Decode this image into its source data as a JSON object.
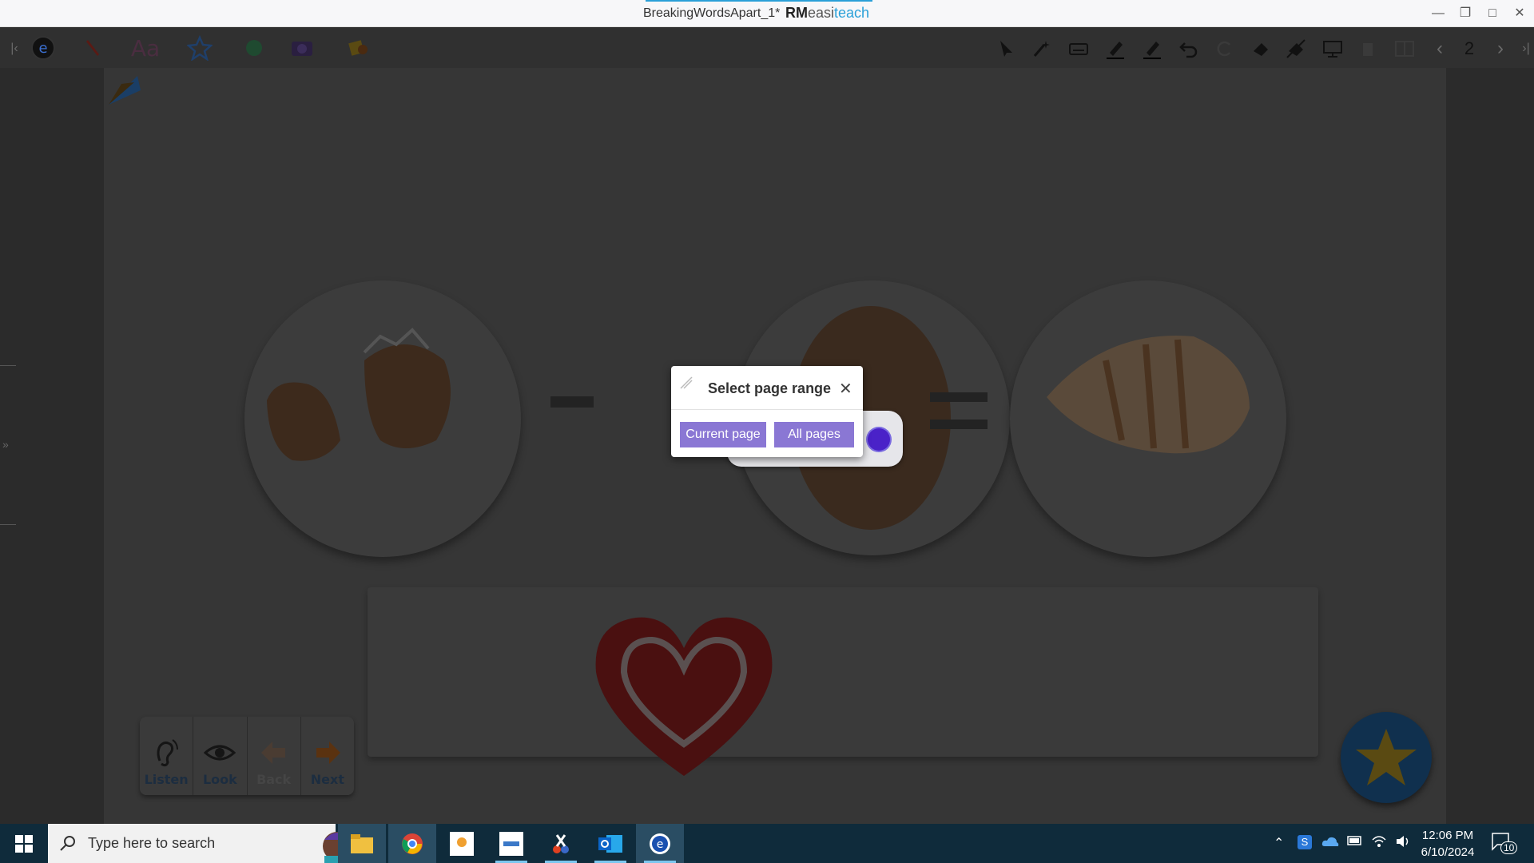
{
  "window": {
    "title": "BreakingWordsApart_1*",
    "brand_rm": "RM",
    "brand_easi": "easi",
    "brand_teach": "teach",
    "controls": [
      "minimize",
      "restore",
      "maximize",
      "close"
    ]
  },
  "toolbar": {
    "left_tools": [
      "easiteach-logo-icon",
      "pen-icon",
      "text-icon",
      "star-icon",
      "hand-icon",
      "camera-icon",
      "shapes-icon"
    ],
    "text_tool_label": "Aa",
    "right_tools": [
      "select-icon",
      "magic-wand-icon",
      "keyboard-icon",
      "highlighter-icon",
      "marker-icon",
      "undo-icon",
      "redo-icon",
      "eraser-icon",
      "clear-icon",
      "screen-icon",
      "delete-icon",
      "page-icon",
      "prev-page-icon",
      "next-page-icon"
    ],
    "page_number": "2"
  },
  "canvas": {
    "operator_minus": "minus",
    "operator_equals": "equals",
    "images": [
      "cracked-egg-shell",
      "egg",
      "sea-shell",
      "heart"
    ]
  },
  "nav_buttons": [
    {
      "label": "Listen",
      "icon": "ear-icon"
    },
    {
      "label": "Look",
      "icon": "eye-icon"
    },
    {
      "label": "Back",
      "icon": "back-arrow-icon"
    },
    {
      "label": "Next",
      "icon": "next-arrow-icon"
    }
  ],
  "dialog": {
    "title": "Select page range",
    "current_page_label": "Current page",
    "all_pages_label": "All pages",
    "close_symbol": "✕"
  },
  "taskbar": {
    "search_placeholder": "Type here to search",
    "apps": [
      "file-explorer",
      "chrome",
      "ignite",
      "learning-panel",
      "snipping-tool",
      "outlook",
      "easiteach"
    ],
    "time": "12:06 PM",
    "date": "6/10/2024",
    "notification_count": "10"
  }
}
